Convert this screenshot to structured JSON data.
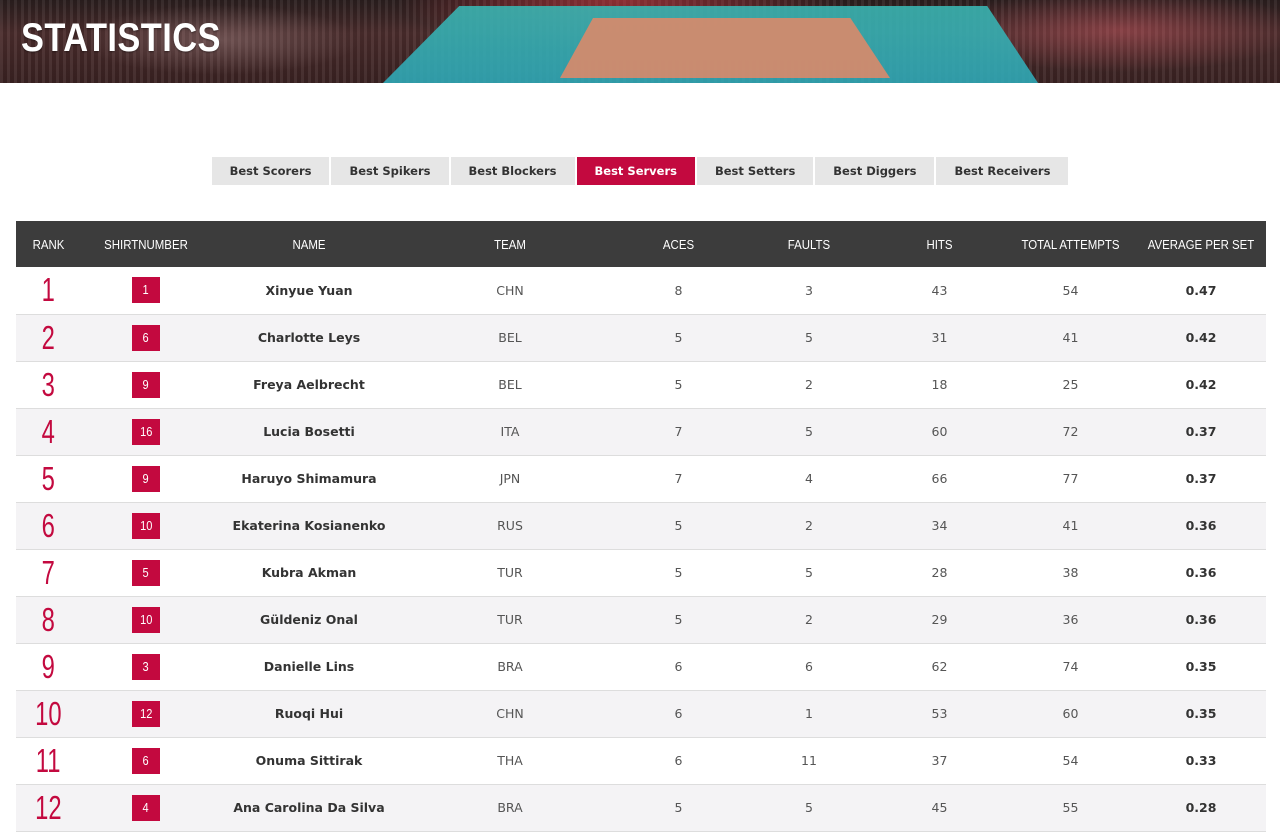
{
  "header": {
    "title": "STATISTICS"
  },
  "tabs": [
    {
      "label": "Best Scorers",
      "active": false
    },
    {
      "label": "Best Spikers",
      "active": false
    },
    {
      "label": "Best Blockers",
      "active": false
    },
    {
      "label": "Best Servers",
      "active": true
    },
    {
      "label": "Best Setters",
      "active": false
    },
    {
      "label": "Best Diggers",
      "active": false
    },
    {
      "label": "Best Receivers",
      "active": false
    }
  ],
  "table": {
    "columns": [
      "RANK",
      "SHIRTNUMBER",
      "NAME",
      "TEAM",
      "ACES",
      "FAULTS",
      "HITS",
      "TOTAL ATTEMPTS",
      "AVERAGE PER SET"
    ],
    "rows": [
      {
        "rank": "1",
        "shirt": "1",
        "name": "Xinyue Yuan",
        "team": "CHN",
        "aces": "8",
        "faults": "3",
        "hits": "43",
        "total": "54",
        "avg": "0.47"
      },
      {
        "rank": "2",
        "shirt": "6",
        "name": "Charlotte Leys",
        "team": "BEL",
        "aces": "5",
        "faults": "5",
        "hits": "31",
        "total": "41",
        "avg": "0.42"
      },
      {
        "rank": "3",
        "shirt": "9",
        "name": "Freya Aelbrecht",
        "team": "BEL",
        "aces": "5",
        "faults": "2",
        "hits": "18",
        "total": "25",
        "avg": "0.42"
      },
      {
        "rank": "4",
        "shirt": "16",
        "name": "Lucia Bosetti",
        "team": "ITA",
        "aces": "7",
        "faults": "5",
        "hits": "60",
        "total": "72",
        "avg": "0.37"
      },
      {
        "rank": "5",
        "shirt": "9",
        "name": "Haruyo Shimamura",
        "team": "JPN",
        "aces": "7",
        "faults": "4",
        "hits": "66",
        "total": "77",
        "avg": "0.37"
      },
      {
        "rank": "6",
        "shirt": "10",
        "name": "Ekaterina Kosianenko",
        "team": "RUS",
        "aces": "5",
        "faults": "2",
        "hits": "34",
        "total": "41",
        "avg": "0.36"
      },
      {
        "rank": "7",
        "shirt": "5",
        "name": "Kubra Akman",
        "team": "TUR",
        "aces": "5",
        "faults": "5",
        "hits": "28",
        "total": "38",
        "avg": "0.36"
      },
      {
        "rank": "8",
        "shirt": "10",
        "name": "Güldeniz Onal",
        "team": "TUR",
        "aces": "5",
        "faults": "2",
        "hits": "29",
        "total": "36",
        "avg": "0.36"
      },
      {
        "rank": "9",
        "shirt": "3",
        "name": "Danielle Lins",
        "team": "BRA",
        "aces": "6",
        "faults": "6",
        "hits": "62",
        "total": "74",
        "avg": "0.35"
      },
      {
        "rank": "10",
        "shirt": "12",
        "name": "Ruoqi Hui",
        "team": "CHN",
        "aces": "6",
        "faults": "1",
        "hits": "53",
        "total": "60",
        "avg": "0.35"
      },
      {
        "rank": "11",
        "shirt": "6",
        "name": "Onuma Sittirak",
        "team": "THA",
        "aces": "6",
        "faults": "11",
        "hits": "37",
        "total": "54",
        "avg": "0.33"
      },
      {
        "rank": "12",
        "shirt": "4",
        "name": "Ana Carolina Da Silva",
        "team": "BRA",
        "aces": "5",
        "faults": "5",
        "hits": "45",
        "total": "55",
        "avg": "0.28"
      }
    ]
  },
  "colors": {
    "accent": "#c3093f",
    "header_bg": "#3c3c3c",
    "tab_bg": "#e6e6e6"
  }
}
